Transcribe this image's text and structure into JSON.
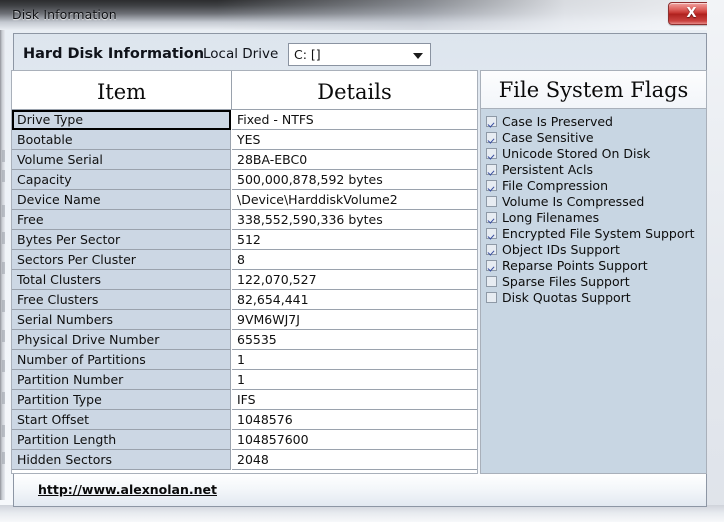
{
  "window": {
    "title": "Disk Information",
    "close_label": "X",
    "close_icon": "close-icon"
  },
  "header": {
    "section_title": "Hard Disk Information",
    "drive_label": "Local Drive",
    "drive_select": {
      "value": "C: []",
      "options": [
        "C: []"
      ],
      "arrow_icon": "chevron-down-icon"
    }
  },
  "grid": {
    "columns": [
      "Item",
      "Details"
    ],
    "selected_row_index": 0,
    "rows": [
      {
        "item": "Drive Type",
        "details": "Fixed - NTFS"
      },
      {
        "item": "Bootable",
        "details": "YES"
      },
      {
        "item": "Volume Serial",
        "details": "28BA-EBC0"
      },
      {
        "item": "Capacity",
        "details": "500,000,878,592 bytes"
      },
      {
        "item": "Device Name",
        "details": "\\Device\\HarddiskVolume2"
      },
      {
        "item": "Free",
        "details": "338,552,590,336 bytes"
      },
      {
        "item": "Bytes Per Sector",
        "details": "512"
      },
      {
        "item": "Sectors Per Cluster",
        "details": "8"
      },
      {
        "item": "Total Clusters",
        "details": "122,070,527"
      },
      {
        "item": "Free Clusters",
        "details": "82,654,441"
      },
      {
        "item": "Serial Numbers",
        "details": "9VM6WJ7J"
      },
      {
        "item": "Physical Drive Number",
        "details": "65535"
      },
      {
        "item": "Number of Partitions",
        "details": "1"
      },
      {
        "item": "Partition Number",
        "details": "1"
      },
      {
        "item": "Partition Type",
        "details": "IFS"
      },
      {
        "item": "Start Offset",
        "details": "1048576"
      },
      {
        "item": "Partition Length",
        "details": "104857600"
      },
      {
        "item": "Hidden Sectors",
        "details": "2048"
      }
    ]
  },
  "flags": {
    "title": "File System Flags",
    "items": [
      {
        "label": "Case Is Preserved",
        "checked": true
      },
      {
        "label": "Case Sensitive",
        "checked": true
      },
      {
        "label": "Unicode Stored On Disk",
        "checked": true
      },
      {
        "label": "Persistent Acls",
        "checked": true
      },
      {
        "label": "File Compression",
        "checked": true
      },
      {
        "label": "Volume Is Compressed",
        "checked": false
      },
      {
        "label": "Long Filenames",
        "checked": true
      },
      {
        "label": "Encrypted File System Support",
        "checked": true
      },
      {
        "label": "Object IDs Support",
        "checked": true
      },
      {
        "label": "Reparse Points Support",
        "checked": true
      },
      {
        "label": "Sparse Files Support",
        "checked": false
      },
      {
        "label": "Disk Quotas Support",
        "checked": false
      }
    ]
  },
  "footer": {
    "link_text": "http://www.alexnolan.net"
  },
  "colors": {
    "key_cell_bg": "#ccd7e4",
    "flags_panel_bg": "#c8d6e3",
    "close_button": "#c02f2b",
    "grid_line": "#9aa2ad"
  }
}
